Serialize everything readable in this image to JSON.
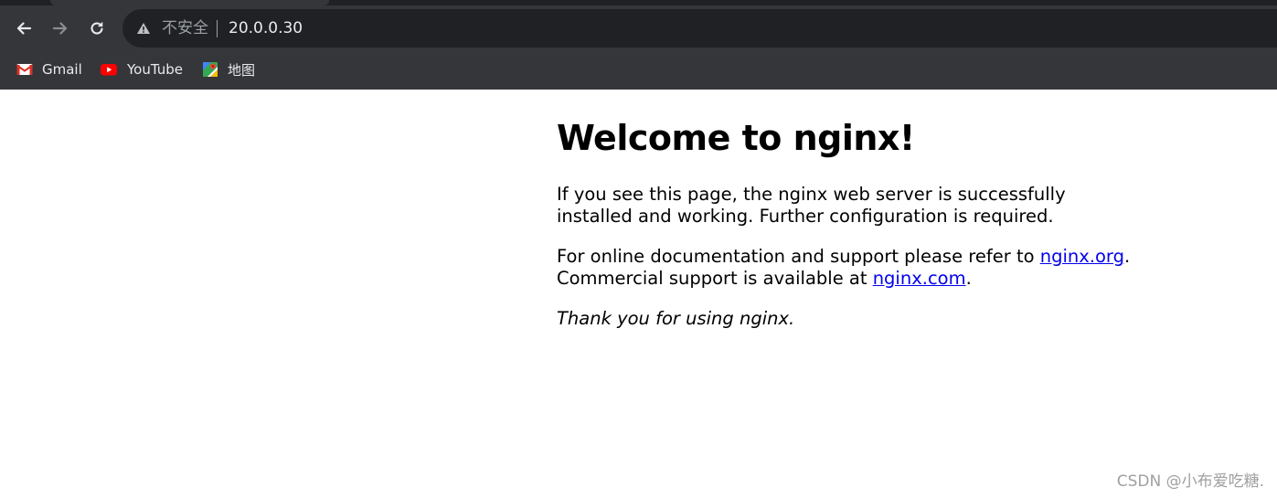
{
  "toolbar": {
    "security_label": "不安全",
    "url": "20.0.0.30"
  },
  "bookmarks": [
    {
      "label": "Gmail",
      "icon": "gmail-icon"
    },
    {
      "label": "YouTube",
      "icon": "youtube-icon"
    },
    {
      "label": "地图",
      "icon": "maps-icon"
    }
  ],
  "page": {
    "heading": "Welcome to nginx!",
    "p1": "If you see this page, the nginx web server is successfully installed and working. Further configuration is required.",
    "p2_lead": "For online documentation and support please refer to ",
    "p2_link1": "nginx.org",
    "p2_mid": ".",
    "p2_line2": "Commercial support is available at ",
    "p2_link2": "nginx.com",
    "p2_end": ".",
    "p3": "Thank you for using nginx."
  },
  "watermark": "CSDN @小布爱吃糖.",
  "colors": {
    "chrome_bg": "#35363a",
    "omnibox_bg": "#202124",
    "link": "#0000ee"
  }
}
